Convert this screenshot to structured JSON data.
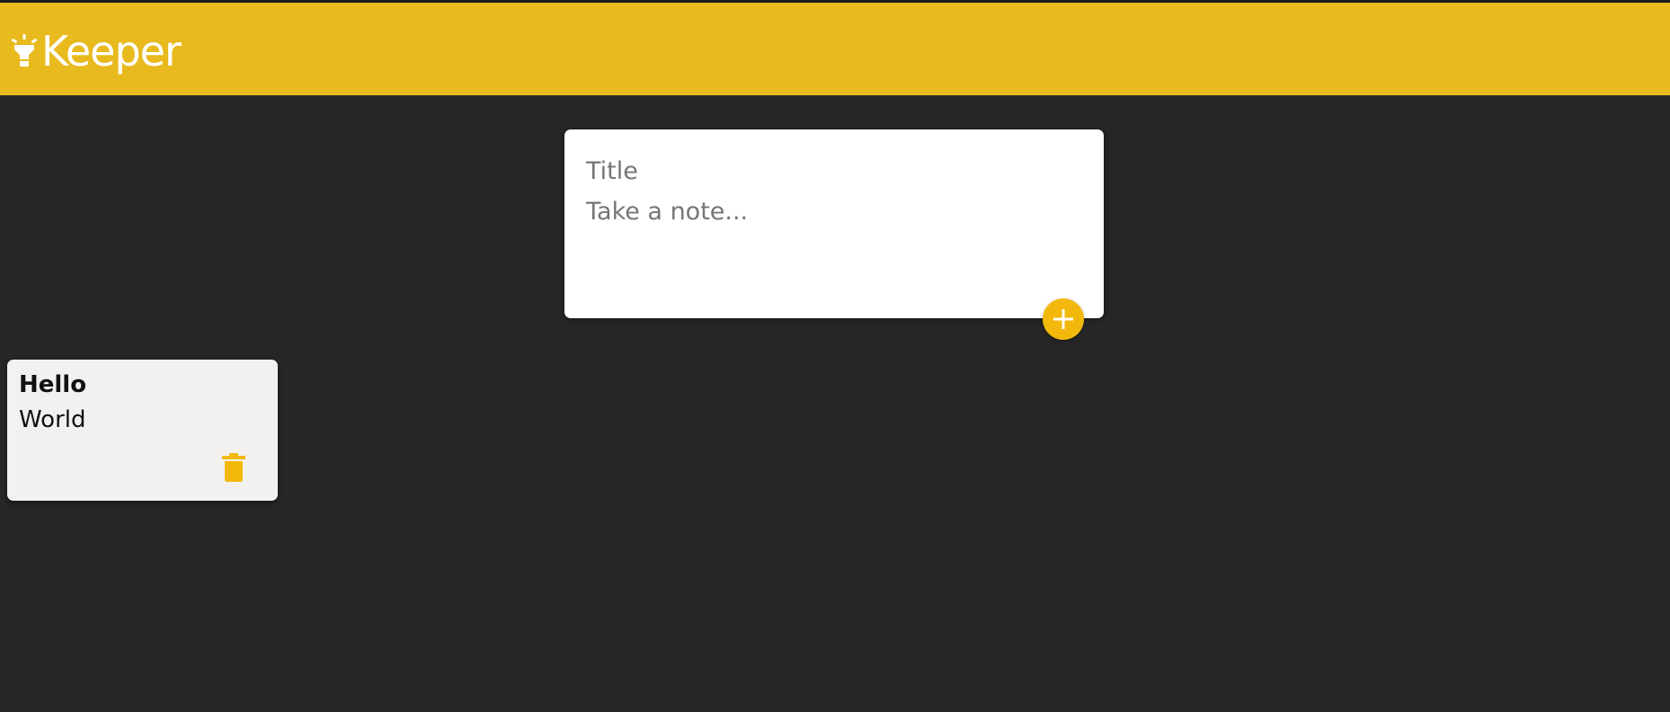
{
  "app": {
    "title": "Keeper",
    "brand_icon": "lightbulb-icon"
  },
  "colors": {
    "header": "#e8ba1e",
    "background": "#262626",
    "accent": "#f2b90c",
    "note_card": "#f3f1f0",
    "text": "#111111"
  },
  "create_note": {
    "title_placeholder": "Title",
    "content_placeholder": "Take a note...",
    "add_icon": "plus-icon"
  },
  "notes": [
    {
      "title": "Hello",
      "content": "World",
      "delete_icon": "trash-icon"
    }
  ]
}
